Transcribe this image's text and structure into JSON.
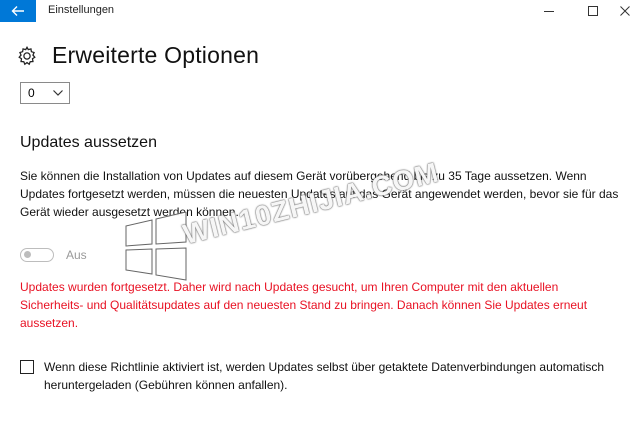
{
  "window": {
    "title": "Einstellungen"
  },
  "page": {
    "title": "Erweiterte Optionen",
    "dropdown_value": "0"
  },
  "section": {
    "title": "Updates aussetzen",
    "description": "Sie können die Installation von Updates auf diesem Gerät vorübergehend bis zu 35 Tage aussetzen. Wenn Updates fortgesetzt werden, müssen die neuesten Updates auf das Gerät angewendet werden, bevor sie für das Gerät wieder ausgesetzt werden können.",
    "toggle_label": "Aus",
    "toggle_state": "off",
    "warning": "Updates wurden fortgesetzt. Daher wird nach Updates gesucht, um Ihren Computer mit den aktuellen Sicherheits- und Qualitätsupdates auf den neuesten Stand zu bringen. Danach können Sie Updates erneut aussetzen."
  },
  "checkbox": {
    "checked": false,
    "label": "Wenn diese Richtlinie aktiviert ist, werden Updates selbst über getaktete Datenverbindungen automatisch heruntergeladen (Gebühren können anfallen)."
  },
  "watermark": {
    "text": "WIN10ZHIJIA.COM"
  },
  "colors": {
    "accent": "#0078d7",
    "warning": "#e81123",
    "disabled": "#9a9a9a"
  },
  "icons": {
    "back": "back-arrow-icon",
    "settings": "gear-icon",
    "dropdown": "chevron-down-icon",
    "minimize": "minimize-icon",
    "maximize": "maximize-icon",
    "close": "close-icon"
  }
}
